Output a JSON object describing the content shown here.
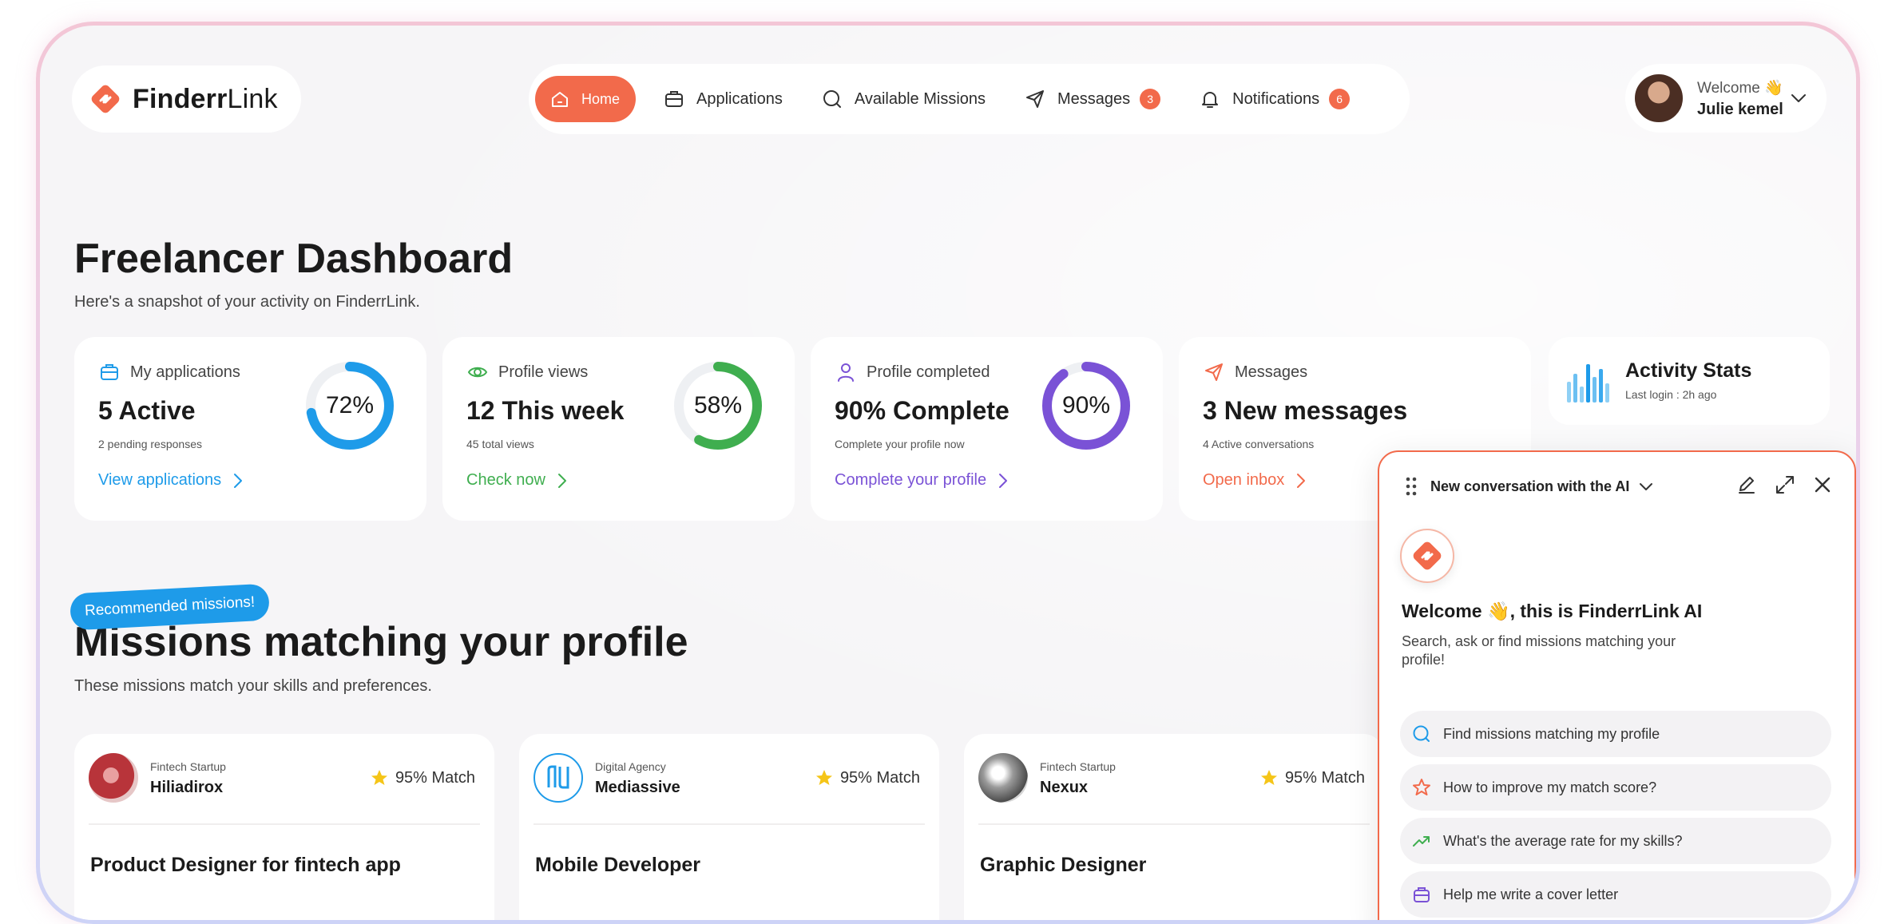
{
  "brand": {
    "name_bold": "Finderr",
    "name_light": "Link",
    "accent": "#f26a4b"
  },
  "nav": {
    "home": "Home",
    "applications": "Applications",
    "missions": "Available Missions",
    "messages": "Messages",
    "messages_count": "3",
    "notifications": "Notifications",
    "notifications_count": "6"
  },
  "user": {
    "greeting": "Welcome 👋",
    "name": "Julie kemel"
  },
  "page": {
    "title": "Freelancer Dashboard",
    "subtitle": "Here's a snapshot of your activity on FinderrLink."
  },
  "stats": [
    {
      "label": "My applications",
      "value": "5 Active",
      "detail": "2 pending responses",
      "link": "View applications",
      "percent_text": "72%",
      "percent": 72,
      "color": "#1e9be9"
    },
    {
      "label": "Profile views",
      "value": "12 This week",
      "detail": "45 total views",
      "link": "Check now",
      "percent_text": "58%",
      "percent": 58,
      "color": "#3fae4f"
    },
    {
      "label": "Profile completed",
      "value": "90% Complete",
      "detail": "Complete your profile now",
      "link": "Complete your profile",
      "percent_text": "90%",
      "percent": 90,
      "color": "#7a52d6"
    },
    {
      "label": "Messages",
      "value": "3 New messages",
      "detail": "4 Active conversations",
      "link": "Open inbox",
      "color": "#f26a4b"
    }
  ],
  "activity": {
    "title": "Activity Stats",
    "subtitle": "Last login : 2h ago"
  },
  "missions": {
    "badge": "Recommended missions!",
    "title": "Missions matching your profile",
    "subtitle": "These missions match your skills and preferences.",
    "items": [
      {
        "category": "Fintech Startup",
        "company": "Hiliadirox",
        "match": "95% Match",
        "title": "Product Designer for fintech app"
      },
      {
        "category": "Digital Agency",
        "company": "Mediassive",
        "match": "95% Match",
        "title": "Mobile Developer"
      },
      {
        "category": "Fintech Startup",
        "company": "Nexux",
        "match": "95% Match",
        "title": "Graphic Designer"
      }
    ]
  },
  "ai": {
    "header": "New conversation with the AI",
    "welcome": "Welcome 👋, this is FinderrLink AI",
    "description": "Search, ask or find missions matching your profile!",
    "suggestions": [
      {
        "text": "Find missions matching my profile",
        "icon": "search-icon"
      },
      {
        "text": "How to improve my match score?",
        "icon": "star-icon"
      },
      {
        "text": "What's the average rate for my skills?",
        "icon": "trend-icon"
      },
      {
        "text": "Help me write a cover letter",
        "icon": "briefcase-icon"
      }
    ]
  }
}
